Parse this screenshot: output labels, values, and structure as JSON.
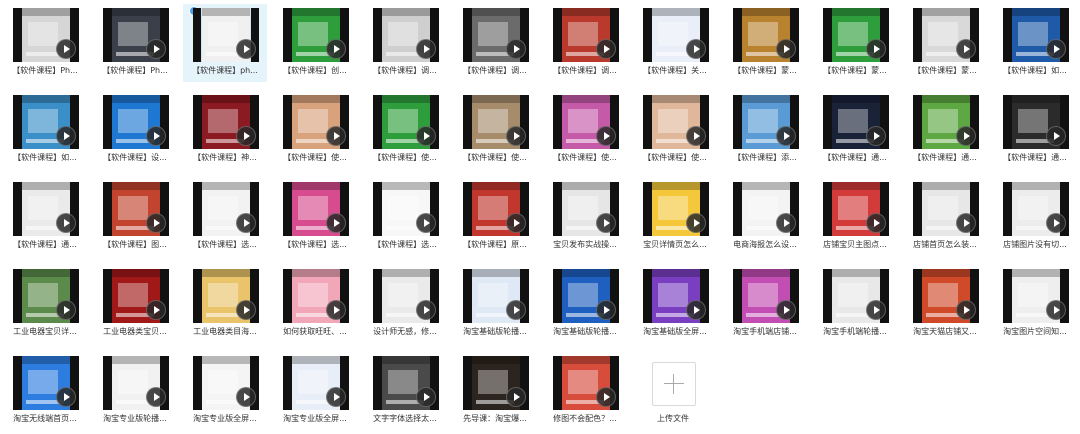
{
  "files": [
    {
      "name": "【软件课程】Ph...",
      "theme": "#d6d6d6"
    },
    {
      "name": "【软件课程】Ph...",
      "theme": "#3a3f4a"
    },
    {
      "name": "【软件课程】ph...",
      "theme": "#f0f0f0",
      "selected": true
    },
    {
      "name": "【软件课程】创...",
      "theme": "#2e9e3c"
    },
    {
      "name": "【软件课程】调...",
      "theme": "#cfcfcf"
    },
    {
      "name": "【软件课程】调...",
      "theme": "#6b6b6b"
    },
    {
      "name": "【软件课程】调...",
      "theme": "#b93a2c"
    },
    {
      "name": "【软件课程】关...",
      "theme": "#e9eef8"
    },
    {
      "name": "【软件课程】蒙...",
      "theme": "#b9822f"
    },
    {
      "name": "【软件课程】蒙...",
      "theme": "#2e9e3c"
    },
    {
      "name": "【软件课程】蒙...",
      "theme": "#d9d9d9"
    },
    {
      "name": "【软件课程】如...",
      "theme": "#1e5aa8"
    },
    {
      "name": "【软件课程】如...",
      "theme": "#3a8fc8"
    },
    {
      "name": "【软件课程】设...",
      "theme": "#1e78d2"
    },
    {
      "name": "【软件课程】神...",
      "theme": "#8c1a22"
    },
    {
      "name": "【软件课程】使...",
      "theme": "#d8a27c"
    },
    {
      "name": "【软件课程】使...",
      "theme": "#2e9e3c"
    },
    {
      "name": "【软件课程】使...",
      "theme": "#a78c6c"
    },
    {
      "name": "【软件课程】使...",
      "theme": "#c55aa8"
    },
    {
      "name": "【软件课程】使...",
      "theme": "#e0b79a"
    },
    {
      "name": "【软件课程】添...",
      "theme": "#5a9bd6"
    },
    {
      "name": "【软件课程】通...",
      "theme": "#1a2238"
    },
    {
      "name": "【软件课程】通...",
      "theme": "#5da842"
    },
    {
      "name": "【软件课程】通...",
      "theme": "#2b2b2b"
    },
    {
      "name": "【软件课程】通...",
      "theme": "#eaeaea"
    },
    {
      "name": "【软件课程】图...",
      "theme": "#c2442f"
    },
    {
      "name": "【软件课程】选...",
      "theme": "#f2f2f2"
    },
    {
      "name": "【软件课程】选...",
      "theme": "#d64c8e"
    },
    {
      "name": "【软件课程】选...",
      "theme": "#f7f7f7"
    },
    {
      "name": "【软件课程】原...",
      "theme": "#c1372d"
    },
    {
      "name": "宝贝发布实战操...",
      "theme": "#e6e6e6"
    },
    {
      "name": "宝贝详情页怎么...",
      "theme": "#f4c83a"
    },
    {
      "name": "电商海报怎么设...",
      "theme": "#f3f3f3"
    },
    {
      "name": "店铺宝贝主图点...",
      "theme": "#d33a3a"
    },
    {
      "name": "店铺首页怎么装...",
      "theme": "#e7e7e7"
    },
    {
      "name": "店铺图片没有切...",
      "theme": "#ececec"
    },
    {
      "name": "工业电器宝贝详...",
      "theme": "#5b8a4a"
    },
    {
      "name": "工业电器类宝贝...",
      "theme": "#a01818"
    },
    {
      "name": "工业电器类目海...",
      "theme": "#e9c46a"
    },
    {
      "name": "如何获取旺旺、...",
      "theme": "#f2a7b8"
    },
    {
      "name": "设计师无感，修...",
      "theme": "#eaeaea"
    },
    {
      "name": "淘宝基础版轮播...",
      "theme": "#dfe9f5"
    },
    {
      "name": "淘宝基础版轮播...",
      "theme": "#1f5fbf"
    },
    {
      "name": "淘宝基础版全屏...",
      "theme": "#7a3fc0"
    },
    {
      "name": "淘宝手机端店铺...",
      "theme": "#c24db3"
    },
    {
      "name": "淘宝手机端轮播...",
      "theme": "#e8e8e8"
    },
    {
      "name": "淘宝天猫店铺又...",
      "theme": "#d04a2a"
    },
    {
      "name": "淘宝图片空间知...",
      "theme": "#eeeeee"
    },
    {
      "name": "淘宝无线端首页...",
      "theme": "#2d7de0"
    },
    {
      "name": "淘宝专业版轮播...",
      "theme": "#f1f1f1"
    },
    {
      "name": "淘宝专业版全屏...",
      "theme": "#f4f4f4"
    },
    {
      "name": "淘宝专业版全屏...",
      "theme": "#e8eef7"
    },
    {
      "name": "文字字体选择太...",
      "theme": "#4a4a4a"
    },
    {
      "name": "先导课：淘宝爆...",
      "theme": "#2c241e"
    },
    {
      "name": "修图不会配色？...",
      "theme": "#d84c3c"
    }
  ],
  "upload": {
    "label": "上传文件"
  }
}
